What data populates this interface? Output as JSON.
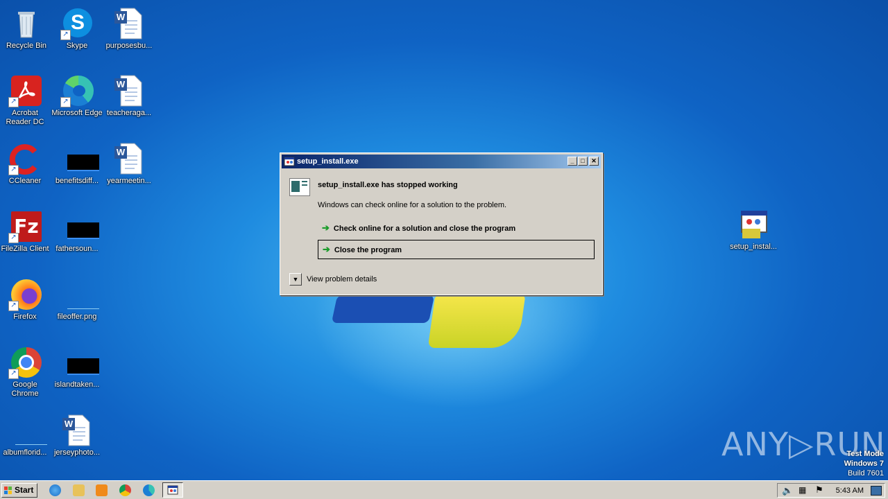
{
  "desktop": {
    "icons": [
      {
        "label": "Recycle Bin"
      },
      {
        "label": "Skype"
      },
      {
        "label": "purposesbu..."
      },
      {
        "label": "Acrobat Reader DC"
      },
      {
        "label": "Microsoft Edge"
      },
      {
        "label": "teacheraga..."
      },
      {
        "label": "CCleaner"
      },
      {
        "label": "benefitsdiff..."
      },
      {
        "label": "yearmeetin..."
      },
      {
        "label": "FileZilla Client"
      },
      {
        "label": "fathersoun..."
      },
      {
        "label": "Firefox"
      },
      {
        "label": "fileoffer.png"
      },
      {
        "label": "Google Chrome"
      },
      {
        "label": "islandtaken..."
      },
      {
        "label": "albumflorid..."
      },
      {
        "label": "jerseyphoto..."
      },
      {
        "label": "setup_instal..."
      }
    ]
  },
  "dialog": {
    "title": "setup_install.exe",
    "heading": "setup_install.exe has stopped working",
    "message": "Windows can check online for a solution to the problem.",
    "option_check_online": "Check online for a solution and close the program",
    "option_close": "Close the program",
    "details_label": "View problem details",
    "min_glyph": "_",
    "max_glyph": "□",
    "close_glyph": "✕"
  },
  "watermark": {
    "text": "ANY▷RUN"
  },
  "os_info": {
    "line1": "Test Mode",
    "line2": "Windows 7",
    "line3": "Build 7601"
  },
  "taskbar": {
    "start_label": "Start",
    "clock": "5:43 AM"
  },
  "colors": {
    "titlebar": "#0a246a",
    "arrow_green": "#1a9c2a",
    "dialog_bg": "#d4d0c8"
  }
}
